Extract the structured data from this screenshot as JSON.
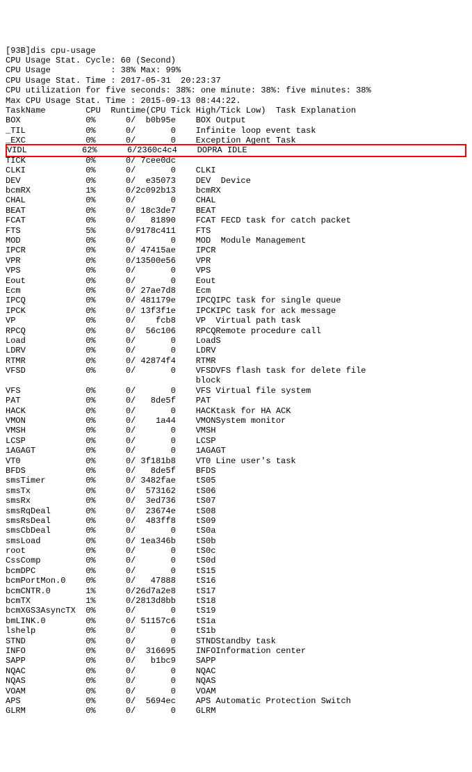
{
  "header": {
    "prompt": "[93B]dis cpu-usage",
    "line1": "CPU Usage Stat. Cycle: 60 (Second)",
    "line2": "CPU Usage            : 38% Max: 99%",
    "line3": "CPU Usage Stat. Time : 2017-05-31  20:23:37",
    "line4": "CPU utilization for five seconds: 38%: one minute: 38%: five minutes: 38%",
    "line5": "Max CPU Usage Stat. Time : 2015-09-13 08:44:22.",
    "columns": "TaskName        CPU  Runtime(CPU Tick High/Tick Low)  Task Explanation"
  },
  "highlight_index": 3,
  "rows": [
    {
      "name": "BOX",
      "cpu": "0%",
      "rhi": "0",
      "rlo": "b0b95e",
      "exp": "BOX Output"
    },
    {
      "name": "_TIL",
      "cpu": "0%",
      "rhi": "0",
      "rlo": "0",
      "exp": "Infinite loop event task"
    },
    {
      "name": "_EXC",
      "cpu": "0%",
      "rhi": "0",
      "rlo": "0",
      "exp": "Exception Agent Task"
    },
    {
      "name": "VIDL",
      "cpu": "62%",
      "rhi": "6",
      "rlo": "2360c4c4",
      "exp": "DOPRA IDLE"
    },
    {
      "name": "TICK",
      "cpu": "0%",
      "rhi": "0",
      "rlo": "7cee0dc",
      "exp": ""
    },
    {
      "name": "CLKI",
      "cpu": "0%",
      "rhi": "0",
      "rlo": "0",
      "exp": "CLKI"
    },
    {
      "name": "DEV",
      "cpu": "0%",
      "rhi": "0",
      "rlo": "e35073",
      "exp": "DEV  Device"
    },
    {
      "name": "bcmRX",
      "cpu": "1%",
      "rhi": "0",
      "rlo": "2c092b13",
      "exp": "bcmRX"
    },
    {
      "name": "CHAL",
      "cpu": "0%",
      "rhi": "0",
      "rlo": "0",
      "exp": "CHAL"
    },
    {
      "name": "BEAT",
      "cpu": "0%",
      "rhi": "0",
      "rlo": "18c3de7",
      "exp": "BEAT"
    },
    {
      "name": "FCAT",
      "cpu": "0%",
      "rhi": "0",
      "rlo": "81890",
      "exp": "FCAT FECD task for catch packet",
      "wrap": true
    },
    {
      "name": "FTS",
      "cpu": "5%",
      "rhi": "0",
      "rlo": "9178c411",
      "exp": "FTS"
    },
    {
      "name": "MOD",
      "cpu": "0%",
      "rhi": "0",
      "rlo": "0",
      "exp": "MOD  Module Management"
    },
    {
      "name": "IPCR",
      "cpu": "0%",
      "rhi": "0",
      "rlo": "47415ae",
      "exp": "IPCR"
    },
    {
      "name": "VPR",
      "cpu": "0%",
      "rhi": "0",
      "rlo": "13500e56",
      "exp": "VPR"
    },
    {
      "name": "VPS",
      "cpu": "0%",
      "rhi": "0",
      "rlo": "0",
      "exp": "VPS"
    },
    {
      "name": "Eout",
      "cpu": "0%",
      "rhi": "0",
      "rlo": "0",
      "exp": "Eout"
    },
    {
      "name": "Ecm",
      "cpu": "0%",
      "rhi": "0",
      "rlo": "27ae7d8",
      "exp": "Ecm"
    },
    {
      "name": "IPCQ",
      "cpu": "0%",
      "rhi": "0",
      "rlo": "481179e",
      "exp": "IPCQIPC task for single queue"
    },
    {
      "name": "IPCK",
      "cpu": "0%",
      "rhi": "0",
      "rlo": "13f3f1e",
      "exp": "IPCKIPC task for ack message"
    },
    {
      "name": "VP",
      "cpu": "0%",
      "rhi": "0",
      "rlo": "fcb8",
      "exp": "VP  Virtual path task"
    },
    {
      "name": "RPCQ",
      "cpu": "0%",
      "rhi": "0",
      "rlo": "56c106",
      "exp": "RPCQRemote procedure call"
    },
    {
      "name": "Load",
      "cpu": "0%",
      "rhi": "0",
      "rlo": "0",
      "exp": "LoadS"
    },
    {
      "name": "LDRV",
      "cpu": "0%",
      "rhi": "0",
      "rlo": "0",
      "exp": "LDRV"
    },
    {
      "name": "RTMR",
      "cpu": "0%",
      "rhi": "0",
      "rlo": "42874f4",
      "exp": "RTMR"
    },
    {
      "name": "VFSD",
      "cpu": "0%",
      "rhi": "0",
      "rlo": "0",
      "exp": "VFSDVFS flash task for delete file block",
      "wrap": true
    },
    {
      "name": "VFS",
      "cpu": "0%",
      "rhi": "0",
      "rlo": "0",
      "exp": "VFS Virtual file system"
    },
    {
      "name": "PAT",
      "cpu": "0%",
      "rhi": "0",
      "rlo": "8de5f",
      "exp": "PAT"
    },
    {
      "name": "HACK",
      "cpu": "0%",
      "rhi": "0",
      "rlo": "0",
      "exp": "HACKtask for HA ACK"
    },
    {
      "name": "VMON",
      "cpu": "0%",
      "rhi": "0",
      "rlo": "1a44",
      "exp": "VMONSystem monitor"
    },
    {
      "name": "VMSH",
      "cpu": "0%",
      "rhi": "0",
      "rlo": "0",
      "exp": "VMSH"
    },
    {
      "name": "LCSP",
      "cpu": "0%",
      "rhi": "0",
      "rlo": "0",
      "exp": "LCSP"
    },
    {
      "name": "1AGAGT",
      "cpu": "0%",
      "rhi": "0",
      "rlo": "0",
      "exp": "1AGAGT"
    },
    {
      "name": "VT0",
      "cpu": "0%",
      "rhi": "0",
      "rlo": "3f181b8",
      "exp": "VT0 Line user's task"
    },
    {
      "name": "BFDS",
      "cpu": "0%",
      "rhi": "0",
      "rlo": "8de5f",
      "exp": "BFDS"
    },
    {
      "name": "smsTimer",
      "cpu": "0%",
      "rhi": "0",
      "rlo": "3482fae",
      "exp": "tS05"
    },
    {
      "name": "smsTx",
      "cpu": "0%",
      "rhi": "0",
      "rlo": "573162",
      "exp": "tS06"
    },
    {
      "name": "smsRx",
      "cpu": "0%",
      "rhi": "0",
      "rlo": "3ed736",
      "exp": "tS07"
    },
    {
      "name": "smsRqDeal",
      "cpu": "0%",
      "rhi": "0",
      "rlo": "23674e",
      "exp": "tS08"
    },
    {
      "name": "smsRsDeal",
      "cpu": "0%",
      "rhi": "0",
      "rlo": "483ff8",
      "exp": "tS09"
    },
    {
      "name": "smsCbDeal",
      "cpu": "0%",
      "rhi": "0",
      "rlo": "0",
      "exp": "tS0a"
    },
    {
      "name": "smsLoad",
      "cpu": "0%",
      "rhi": "0",
      "rlo": "1ea346b",
      "exp": "tS0b"
    },
    {
      "name": "root",
      "cpu": "0%",
      "rhi": "0",
      "rlo": "0",
      "exp": "tS0c"
    },
    {
      "name": "CssComp",
      "cpu": "0%",
      "rhi": "0",
      "rlo": "0",
      "exp": "tS0d"
    },
    {
      "name": "bcmDPC",
      "cpu": "0%",
      "rhi": "0",
      "rlo": "0",
      "exp": "tS15"
    },
    {
      "name": "bcmPortMon.0",
      "cpu": "0%",
      "rhi": "0",
      "rlo": "47888",
      "exp": "tS16"
    },
    {
      "name": "bcmCNTR.0",
      "cpu": "1%",
      "rhi": "0",
      "rlo": "26d7a2e8",
      "exp": "tS17"
    },
    {
      "name": "bcmTX",
      "cpu": "1%",
      "rhi": "0",
      "rlo": "2813d8bb",
      "exp": "tS18"
    },
    {
      "name": "bcmXGS3AsyncTX",
      "cpu": "0%",
      "rhi": "0",
      "rlo": "0",
      "exp": "tS19"
    },
    {
      "name": "bmLINK.0",
      "cpu": "0%",
      "rhi": "0",
      "rlo": "51157c6",
      "exp": "tS1a"
    },
    {
      "name": "lshelp",
      "cpu": "0%",
      "rhi": "0",
      "rlo": "0",
      "exp": "tS1b"
    },
    {
      "name": "STND",
      "cpu": "0%",
      "rhi": "0",
      "rlo": "0",
      "exp": "STNDStandby task"
    },
    {
      "name": "INFO",
      "cpu": "0%",
      "rhi": "0",
      "rlo": "316695",
      "exp": "INFOInformation center"
    },
    {
      "name": "SAPP",
      "cpu": "0%",
      "rhi": "0",
      "rlo": "b1bc9",
      "exp": "SAPP"
    },
    {
      "name": "NQAC",
      "cpu": "0%",
      "rhi": "0",
      "rlo": "0",
      "exp": "NQAC"
    },
    {
      "name": "NQAS",
      "cpu": "0%",
      "rhi": "0",
      "rlo": "0",
      "exp": "NQAS"
    },
    {
      "name": "VOAM",
      "cpu": "0%",
      "rhi": "0",
      "rlo": "0",
      "exp": "VOAM"
    },
    {
      "name": "APS",
      "cpu": "0%",
      "rhi": "0",
      "rlo": "5694ec",
      "exp": "APS Automatic Protection Switch",
      "wrap": true
    },
    {
      "name": "GLRM",
      "cpu": "0%",
      "rhi": "0",
      "rlo": "0",
      "exp": "GLRM"
    }
  ]
}
